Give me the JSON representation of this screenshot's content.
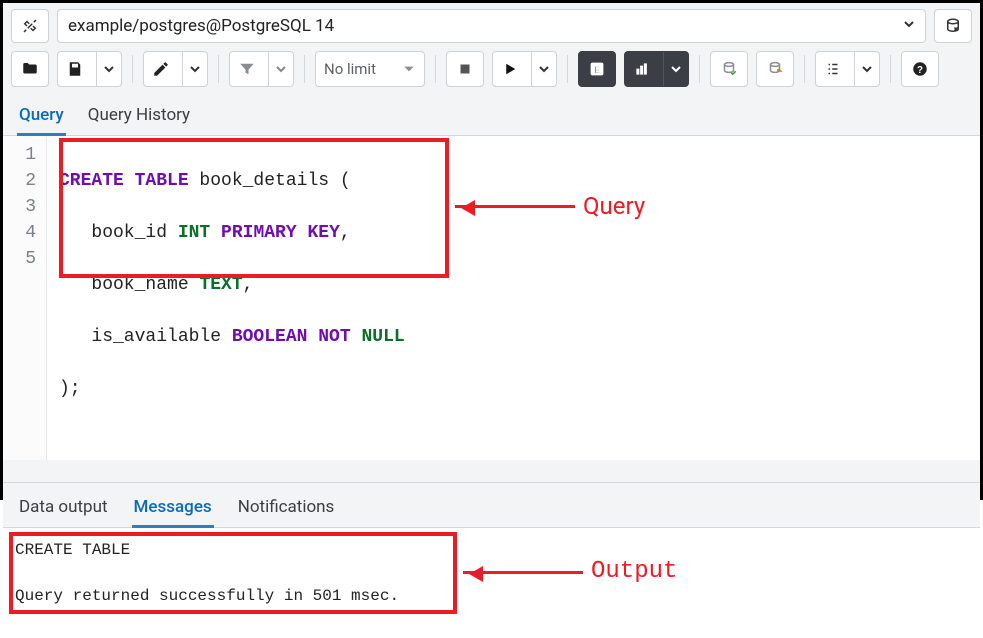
{
  "connection": {
    "label": "example/postgres@PostgreSQL 14"
  },
  "toolbar": {
    "nolimit_label": "No limit"
  },
  "editor_tabs": {
    "query": "Query",
    "history": "Query History"
  },
  "editor": {
    "lines": [
      "1",
      "2",
      "3",
      "4",
      "5"
    ],
    "code": {
      "l1_kw": "CREATE TABLE",
      "l1_rest": " book_details (",
      "l2_a": "   book_id ",
      "l2_int": "INT ",
      "l2_pk": "PRIMARY KEY",
      "l2_comma": ",",
      "l3_a": "   book_name ",
      "l3_text": "TEXT",
      "l3_comma": ",",
      "l4_a": "   is_available ",
      "l4_bool": "BOOLEAN ",
      "l4_not": "NOT ",
      "l4_null": "NULL",
      "l5": ");"
    }
  },
  "result_tabs": {
    "data": "Data output",
    "messages": "Messages",
    "notifications": "Notifications"
  },
  "messages": {
    "line1": "CREATE TABLE",
    "line2": "Query returned successfully in 501 msec."
  },
  "annotations": {
    "query_label": "Query",
    "output_label": "Output"
  }
}
